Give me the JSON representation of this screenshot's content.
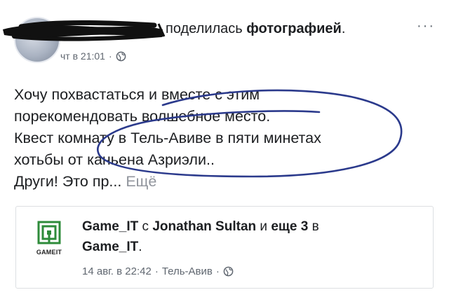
{
  "post": {
    "action_text": "поделилась",
    "action_object": "фотографией",
    "action_suffix": ".",
    "timestamp": "чт в 21:01",
    "meta_separator": "·",
    "privacy_icon": "globe-icon",
    "more_label": "···",
    "body_lines": [
      "Хочу похвастаться и вместе с этим",
      "порекомендовать волшебное место.",
      "Квест комнату в Тель-Авиве в пяти минетах",
      "хотьбы от каньена Азриэли..",
      "Други! Это пр..."
    ],
    "see_more": "Ещё",
    "annotation_color": "#2b3a8c"
  },
  "shared": {
    "logo_text": "GAMEIT",
    "logo_color": "#2e8b3a",
    "page_name": "Game_IT",
    "with_word": "с",
    "tagged_person": "Jonathan Sultan",
    "and_word": "и",
    "others_link": "еще 3",
    "in_word": "в",
    "location_page": "Game_IT",
    "location_suffix": ".",
    "date": "14 авг. в 22:42",
    "separator": "·",
    "place": "Тель-Авив",
    "privacy_icon": "globe-icon"
  }
}
